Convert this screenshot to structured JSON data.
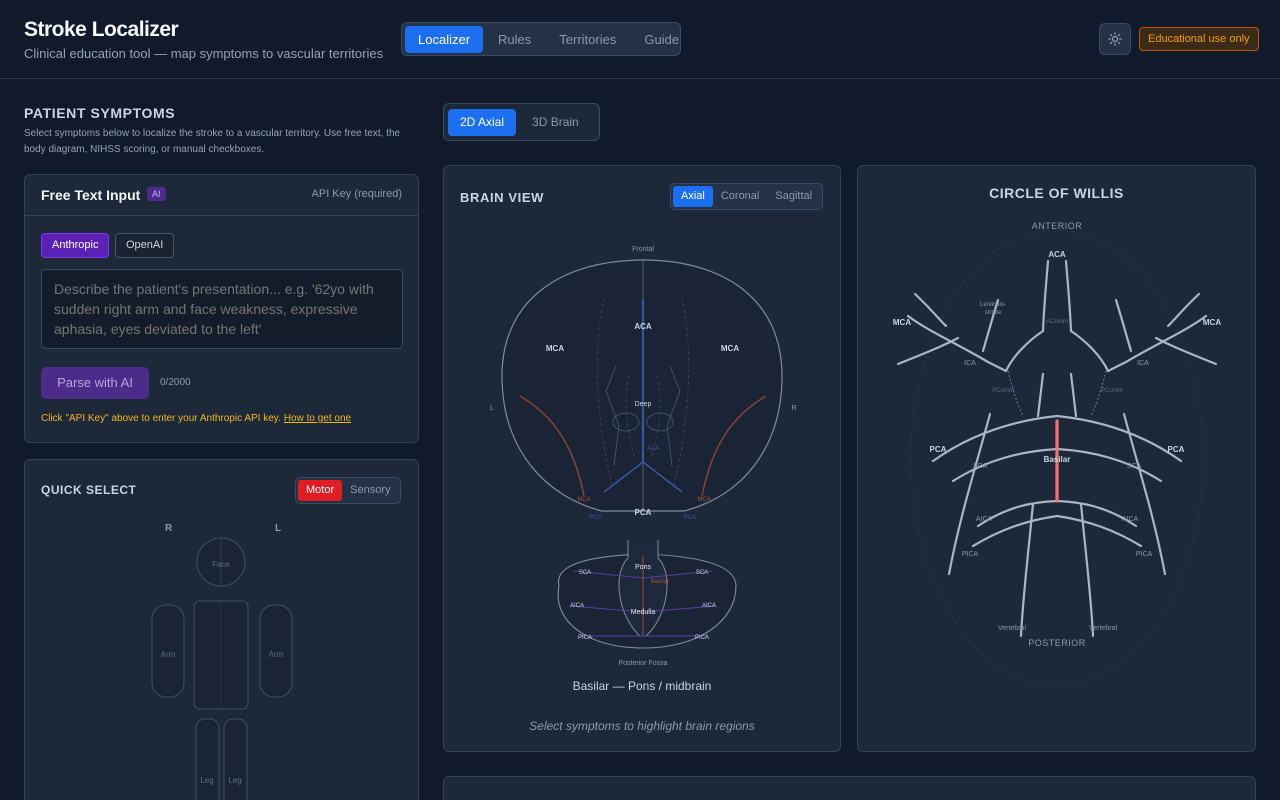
{
  "header": {
    "title": "Stroke Localizer",
    "subtitle": "Clinical education tool — map symptoms to vascular territories",
    "nav": [
      "Localizer",
      "Rules",
      "Territories",
      "Guide"
    ],
    "badge": "Educational use only"
  },
  "symptoms": {
    "title": "PATIENT SYMPTOMS",
    "description": "Select symptoms below to localize the stroke to a vascular territory. Use free text, the body diagram, NIHSS scoring, or manual checkboxes."
  },
  "free_text": {
    "title": "Free Text Input",
    "ai_badge": "AI",
    "api_key": "API Key (required)",
    "providers": [
      "Anthropic",
      "OpenAI"
    ],
    "placeholder": "Describe the patient's presentation... e.g. '62yo with sudden right arm and face weakness, expressive aphasia, eyes deviated to the left'",
    "parse_label": "Parse with AI",
    "counter": "0/2000",
    "note": "Click \"API Key\" above to enter your Anthropic API key.",
    "note_link": "How to get one"
  },
  "quick_select": {
    "title": "QUICK SELECT",
    "modes": [
      "Motor",
      "Sensory"
    ],
    "side_r": "R",
    "side_l": "L",
    "parts": {
      "face": "Face",
      "arm": "Arm",
      "leg": "Leg"
    }
  },
  "view_modes": [
    "2D Axial",
    "3D Brain"
  ],
  "brain_view": {
    "title": "BRAIN VIEW",
    "planes": [
      "Axial",
      "Coronal",
      "Sagittal"
    ],
    "labels": {
      "frontal": "Frontal",
      "aca": "ACA",
      "mca": "MCA",
      "deep": "Deep",
      "pca": "PCA",
      "l": "L",
      "r": "R",
      "pons": "Pons",
      "medulla": "Medulla",
      "basilar": "Basilar",
      "sca": "SCA",
      "aica": "AICA",
      "pica": "PICA",
      "fossa": "Posterior Fossa"
    },
    "caption": "Basilar — Pons / midbrain",
    "hint": "Select symptoms to highlight brain regions"
  },
  "willis": {
    "title": "CIRCLE OF WILLIS",
    "labels": {
      "anterior": "ANTERIOR",
      "posterior": "POSTERIOR",
      "aca": "ACA",
      "mca": "MCA",
      "ica": "ICA",
      "lenticulo": "Lenticulo-",
      "striate": "striate",
      "acomm": "AComm",
      "pcomm": "PComm",
      "pca": "PCA",
      "sca": "SCA",
      "basilar": "Basilar",
      "aica": "AICA",
      "pica": "PICA",
      "vertebral": "Vertebral"
    }
  },
  "colors": {
    "accent": "#1d6ff2",
    "motor": "#e11d24",
    "ai": "#5b21b6",
    "highlight": "#f87171"
  }
}
